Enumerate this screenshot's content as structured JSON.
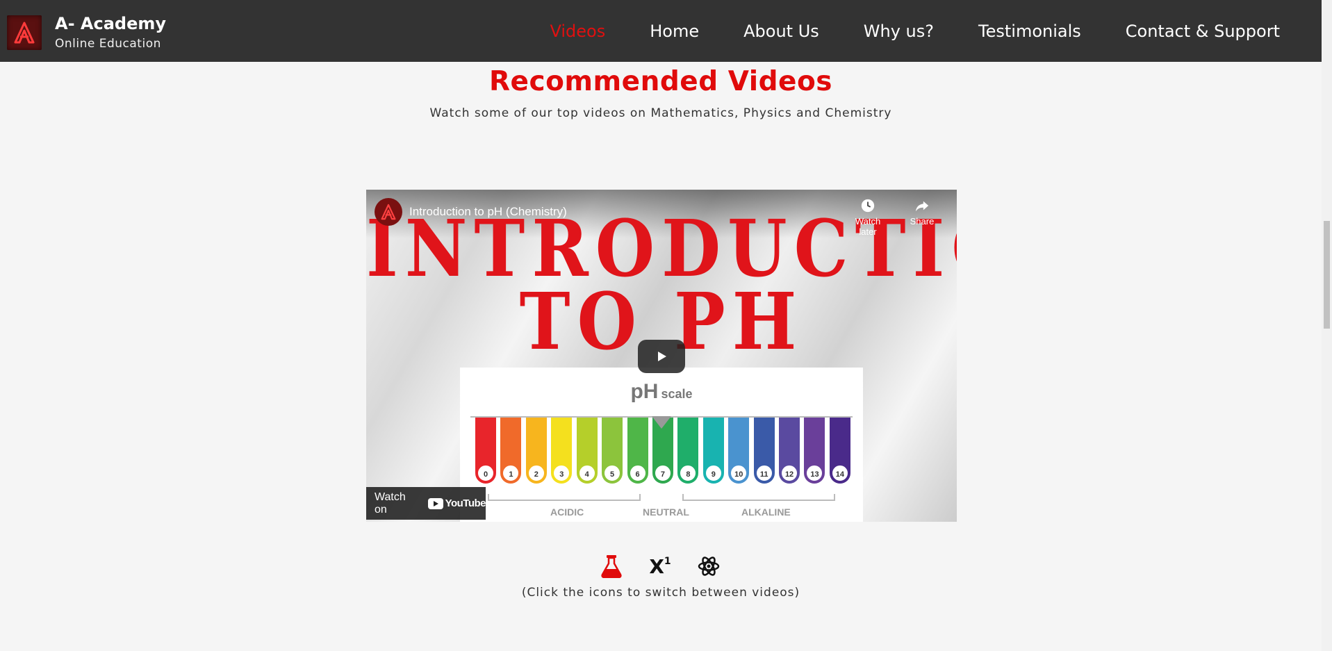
{
  "brand": {
    "title": "A- Academy",
    "subtitle": "Online Education",
    "logo_letter": "A"
  },
  "nav": {
    "items": [
      {
        "label": "Videos",
        "active": true
      },
      {
        "label": "Home",
        "active": false
      },
      {
        "label": "About Us",
        "active": false
      },
      {
        "label": "Why us?",
        "active": false
      },
      {
        "label": "Testimonials",
        "active": false
      },
      {
        "label": "Contact & Support",
        "active": false
      }
    ]
  },
  "section": {
    "title": "Recommended Videos",
    "subtitle": "Watch some of our top videos on Mathematics, Physics and Chemistry"
  },
  "video": {
    "title": "Introduction to pH (Chemistry)",
    "watch_later_label": "Watch later",
    "share_label": "Share",
    "watch_on_label": "Watch on",
    "youtube_label": "YouTube",
    "thumbnail": {
      "line1": "INTRODUCTION",
      "line2": "TO PH",
      "scale_big": "pH",
      "scale_small": "scale",
      "numbers": [
        "0",
        "1",
        "2",
        "3",
        "4",
        "5",
        "6",
        "7",
        "8",
        "9",
        "10",
        "11",
        "12",
        "13",
        "14"
      ],
      "bar_colors": [
        "#e8252b",
        "#f06a2a",
        "#f7b51e",
        "#f4e01e",
        "#b5cf2a",
        "#8cc43c",
        "#4fb648",
        "#2fa84f",
        "#1fae6a",
        "#18b3b0",
        "#4a93cf",
        "#3a5aa8",
        "#5a4aa0",
        "#6a3f9a",
        "#4a2a8a"
      ],
      "labels": {
        "acidic": "ACIDIC",
        "neutral": "NEUTRAL",
        "alkaline": "ALKALINE"
      }
    }
  },
  "switcher": {
    "icons": [
      {
        "name": "flask-icon",
        "active": true,
        "color": "#e00b0b"
      },
      {
        "name": "superscript-icon",
        "active": false,
        "color": "#111111"
      },
      {
        "name": "atom-icon",
        "active": false,
        "color": "#111111"
      }
    ],
    "superscript_base": "X",
    "superscript_exp": "1",
    "hint": "(Click the icons to switch between videos)"
  }
}
